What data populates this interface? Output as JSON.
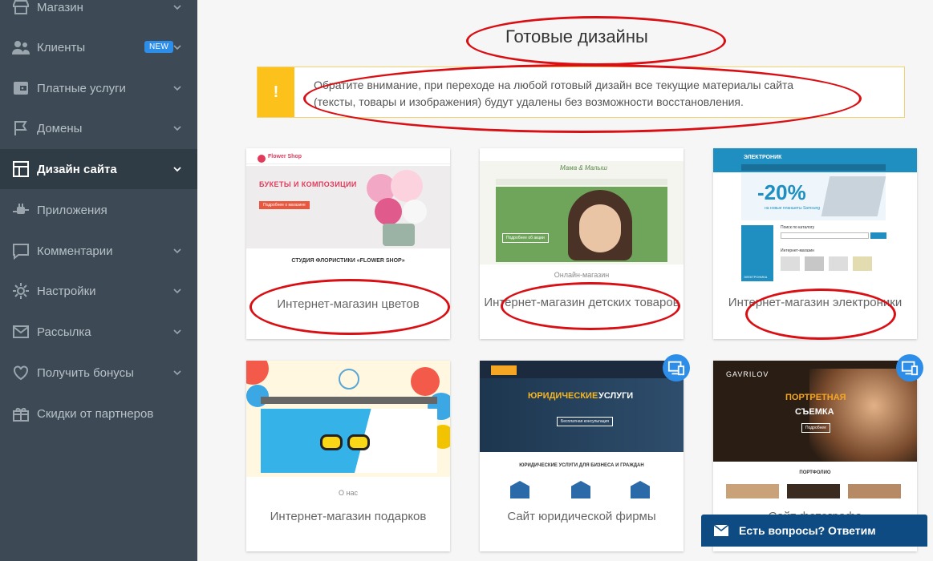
{
  "sidebar": {
    "items": [
      {
        "label": "Магазин",
        "icon": "store-icon"
      },
      {
        "label": "Клиенты",
        "icon": "users-icon",
        "badge": "NEW"
      },
      {
        "label": "Платные услуги",
        "icon": "wallet-icon"
      },
      {
        "label": "Домены",
        "icon": "flag-icon"
      },
      {
        "label": "Дизайн сайта",
        "icon": "layout-icon",
        "active": true
      },
      {
        "label": "Приложения",
        "icon": "plug-icon"
      },
      {
        "label": "Комментарии",
        "icon": "comment-icon"
      },
      {
        "label": "Настройки",
        "icon": "gear-icon"
      },
      {
        "label": "Рассылка",
        "icon": "envelope-icon"
      },
      {
        "label": "Получить бонусы",
        "icon": "heart-icon"
      },
      {
        "label": "Скидки от партнеров",
        "icon": "gift-icon"
      }
    ]
  },
  "main": {
    "title": "Готовые дизайны",
    "alert": {
      "icon": "!",
      "text": "Обратите внимание, при переходе на любой готовый дизайн все текущие материалы сайта (тексты, товары и изображения) будут удалены без возможности восстановления."
    },
    "cards": [
      {
        "title": "Интернет-магазин цветов",
        "preview": {
          "brand": "Flower Shop",
          "hero": "БУКЕТЫ И КОМПОЗИЦИИ",
          "button": "Подробнее о магазине",
          "heading": "СТУДИЯ ФЛОРИСТИКИ «FLOWER SHOP»"
        }
      },
      {
        "title": "Интернет-магазин детских товаров",
        "preview": {
          "subtitle": "Онлайн-магазин",
          "logo": "Мама & Малыш",
          "button": "Подробнее об акции"
        }
      },
      {
        "title": "Интернет-магазин электроники",
        "preview": {
          "brand": "ЭЛЕКТРОНИК",
          "promo": "-20%",
          "promo_sub": "на новые планшеты Samsung",
          "catalog": "Поиск по каталогу",
          "section": "Интернет-магазин",
          "side": "ЭЛЕКТРОНИКА"
        }
      },
      {
        "title": "Интернет-магазин подарков",
        "preview": {
          "subtitle": "О нас"
        }
      },
      {
        "title": "Сайт юридической фирмы",
        "preview": {
          "hero_a": "ЮРИДИЧЕСКИЕ",
          "hero_b": "УСЛУГИ",
          "button": "Бесплатная консультация",
          "heading": "ЮРИДИЧЕСКИЕ УСЛУГИ ДЛЯ БИЗНЕСА И ГРАЖДАН"
        },
        "device_icon": "devices-icon"
      },
      {
        "title": "Сайт фотографа",
        "preview": {
          "brand": "GAVRILOV",
          "hero_a": "ПОРТРЕТНАЯ",
          "hero_b": "СЪЕМКА",
          "button": "Подробнее",
          "heading": "ПОРТФОЛИО"
        },
        "device_icon": "devices-icon"
      }
    ]
  },
  "chat": {
    "label": "Есть вопросы? Ответим"
  },
  "colors": {
    "sidebar": "#3d4a55",
    "accent": "#2d8ee9",
    "alert": "#fcc11a",
    "annotation": "#d90f14"
  }
}
